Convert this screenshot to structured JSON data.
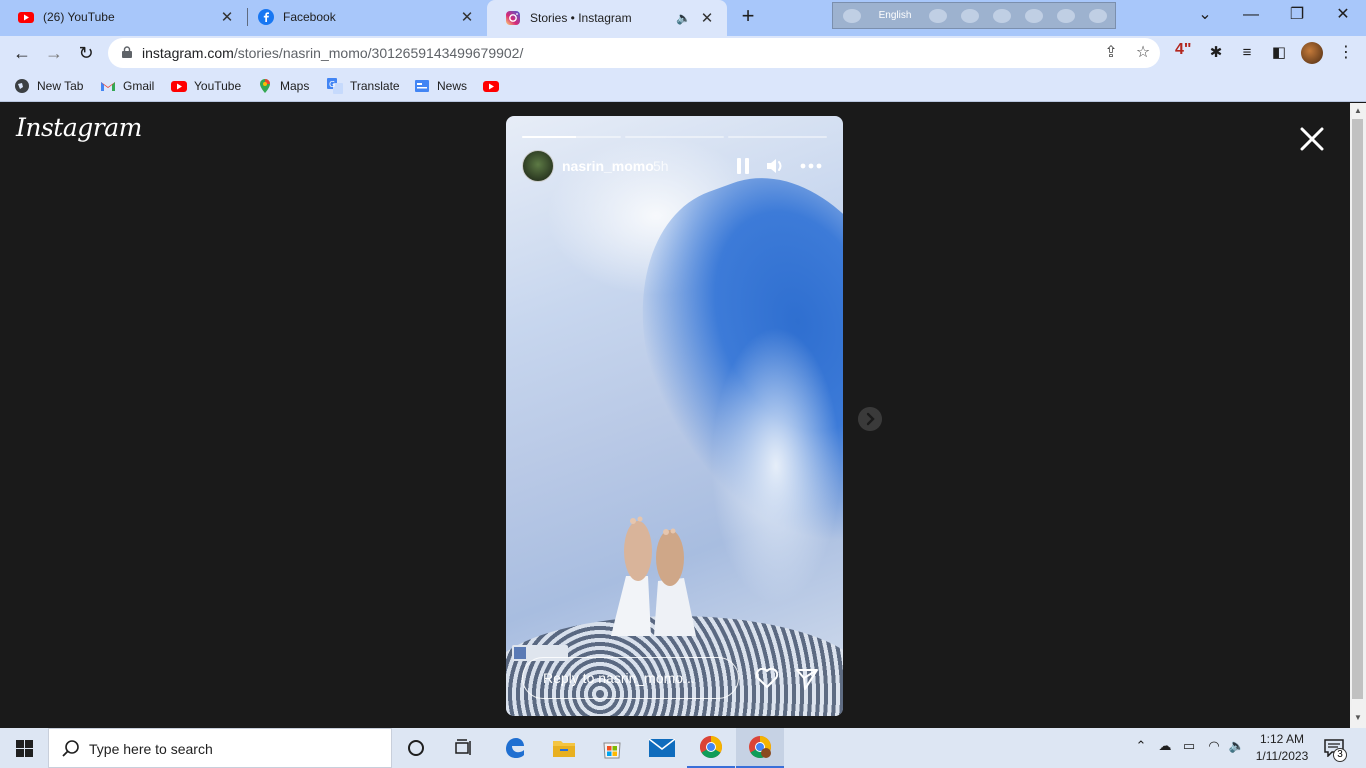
{
  "browser": {
    "tabs": [
      {
        "title": "(26) YouTube",
        "icon": "youtube-icon"
      },
      {
        "title": "Facebook",
        "icon": "facebook-icon"
      },
      {
        "title": "Stories • Instagram",
        "icon": "instagram-icon",
        "active": true,
        "audio": true
      }
    ],
    "language_bar": {
      "language": "English"
    },
    "url": {
      "host": "instagram.com",
      "path": "/stories/nasrin_momo/3012659143499679902/"
    },
    "extension_badge": "4\""
  },
  "bookmarks": [
    {
      "label": "New Tab",
      "icon": "globe-icon"
    },
    {
      "label": "Gmail",
      "icon": "gmail-icon"
    },
    {
      "label": "YouTube",
      "icon": "youtube-icon"
    },
    {
      "label": "Maps",
      "icon": "maps-icon"
    },
    {
      "label": "Translate",
      "icon": "translate-icon"
    },
    {
      "label": "News",
      "icon": "news-icon"
    },
    {
      "label": "",
      "icon": "youtube-icon"
    }
  ],
  "instagram": {
    "logo": "Instagram",
    "story": {
      "username": "nasrin_momo",
      "age": "5h",
      "segments": 3,
      "current_segment": 0,
      "current_progress": 0.55,
      "reply_placeholder": "Reply to nasrin_momo..."
    }
  },
  "taskbar": {
    "search_placeholder": "Type here to search",
    "time": "1:12 AM",
    "date": "1/11/2023",
    "notification_count": "3"
  },
  "colors": {
    "tabstrip": "#a8c7fa",
    "toolbar": "#dbe6fb",
    "page_bg": "#1a1a1a",
    "taskbar": "#dde6f3"
  }
}
